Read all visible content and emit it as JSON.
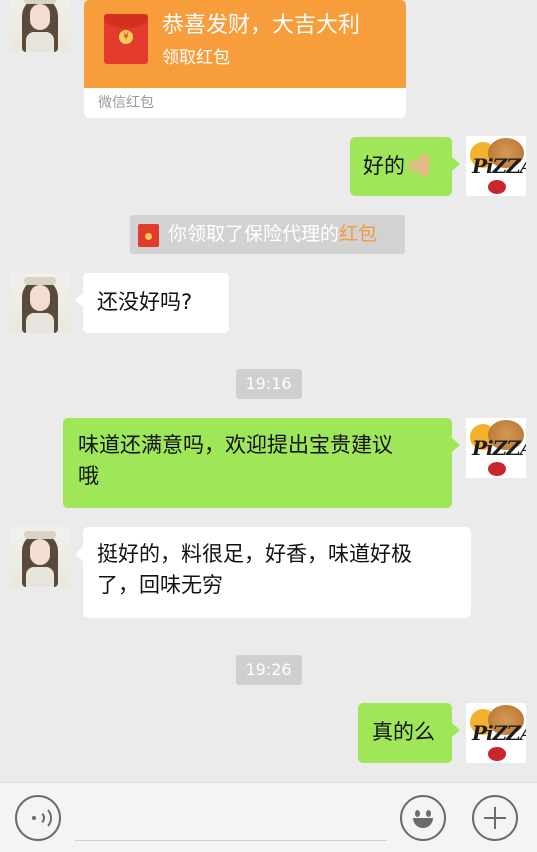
{
  "messages": {
    "red_packet": {
      "title": "恭喜发财，大吉大利",
      "subtitle": "领取红包",
      "footer": "微信红包",
      "coin_symbol": "¥"
    },
    "m1": {
      "text": "好的",
      "emoji": "ok-hand"
    },
    "notice": {
      "prefix": "你领取了保险代理的",
      "link": "红包"
    },
    "m2": {
      "text": "还没好吗?"
    },
    "time1": "19:16",
    "m3": {
      "line1": "味道还满意吗，欢迎提出宝贵建议",
      "line2": "哦"
    },
    "m4": {
      "line1": "挺好的，料很足，好香，味道好极",
      "line2": "了，回味无穷"
    },
    "time2": "19:26",
    "m5": {
      "text": "真的么"
    }
  },
  "avatars": {
    "contact": "girl-avatar",
    "self": "pizza-logo-avatar",
    "self_logo_text": "PiZZA"
  },
  "input_bar": {
    "voice_icon": "voice-icon",
    "emoji_icon": "emoji-icon",
    "plus_icon": "plus-icon",
    "placeholder": ""
  },
  "colors": {
    "outgoing_bubble": "#9fe658",
    "incoming_bubble": "#ffffff",
    "red_packet": "#f79d3c",
    "link": "#f29b38",
    "background": "#ebebeb"
  }
}
